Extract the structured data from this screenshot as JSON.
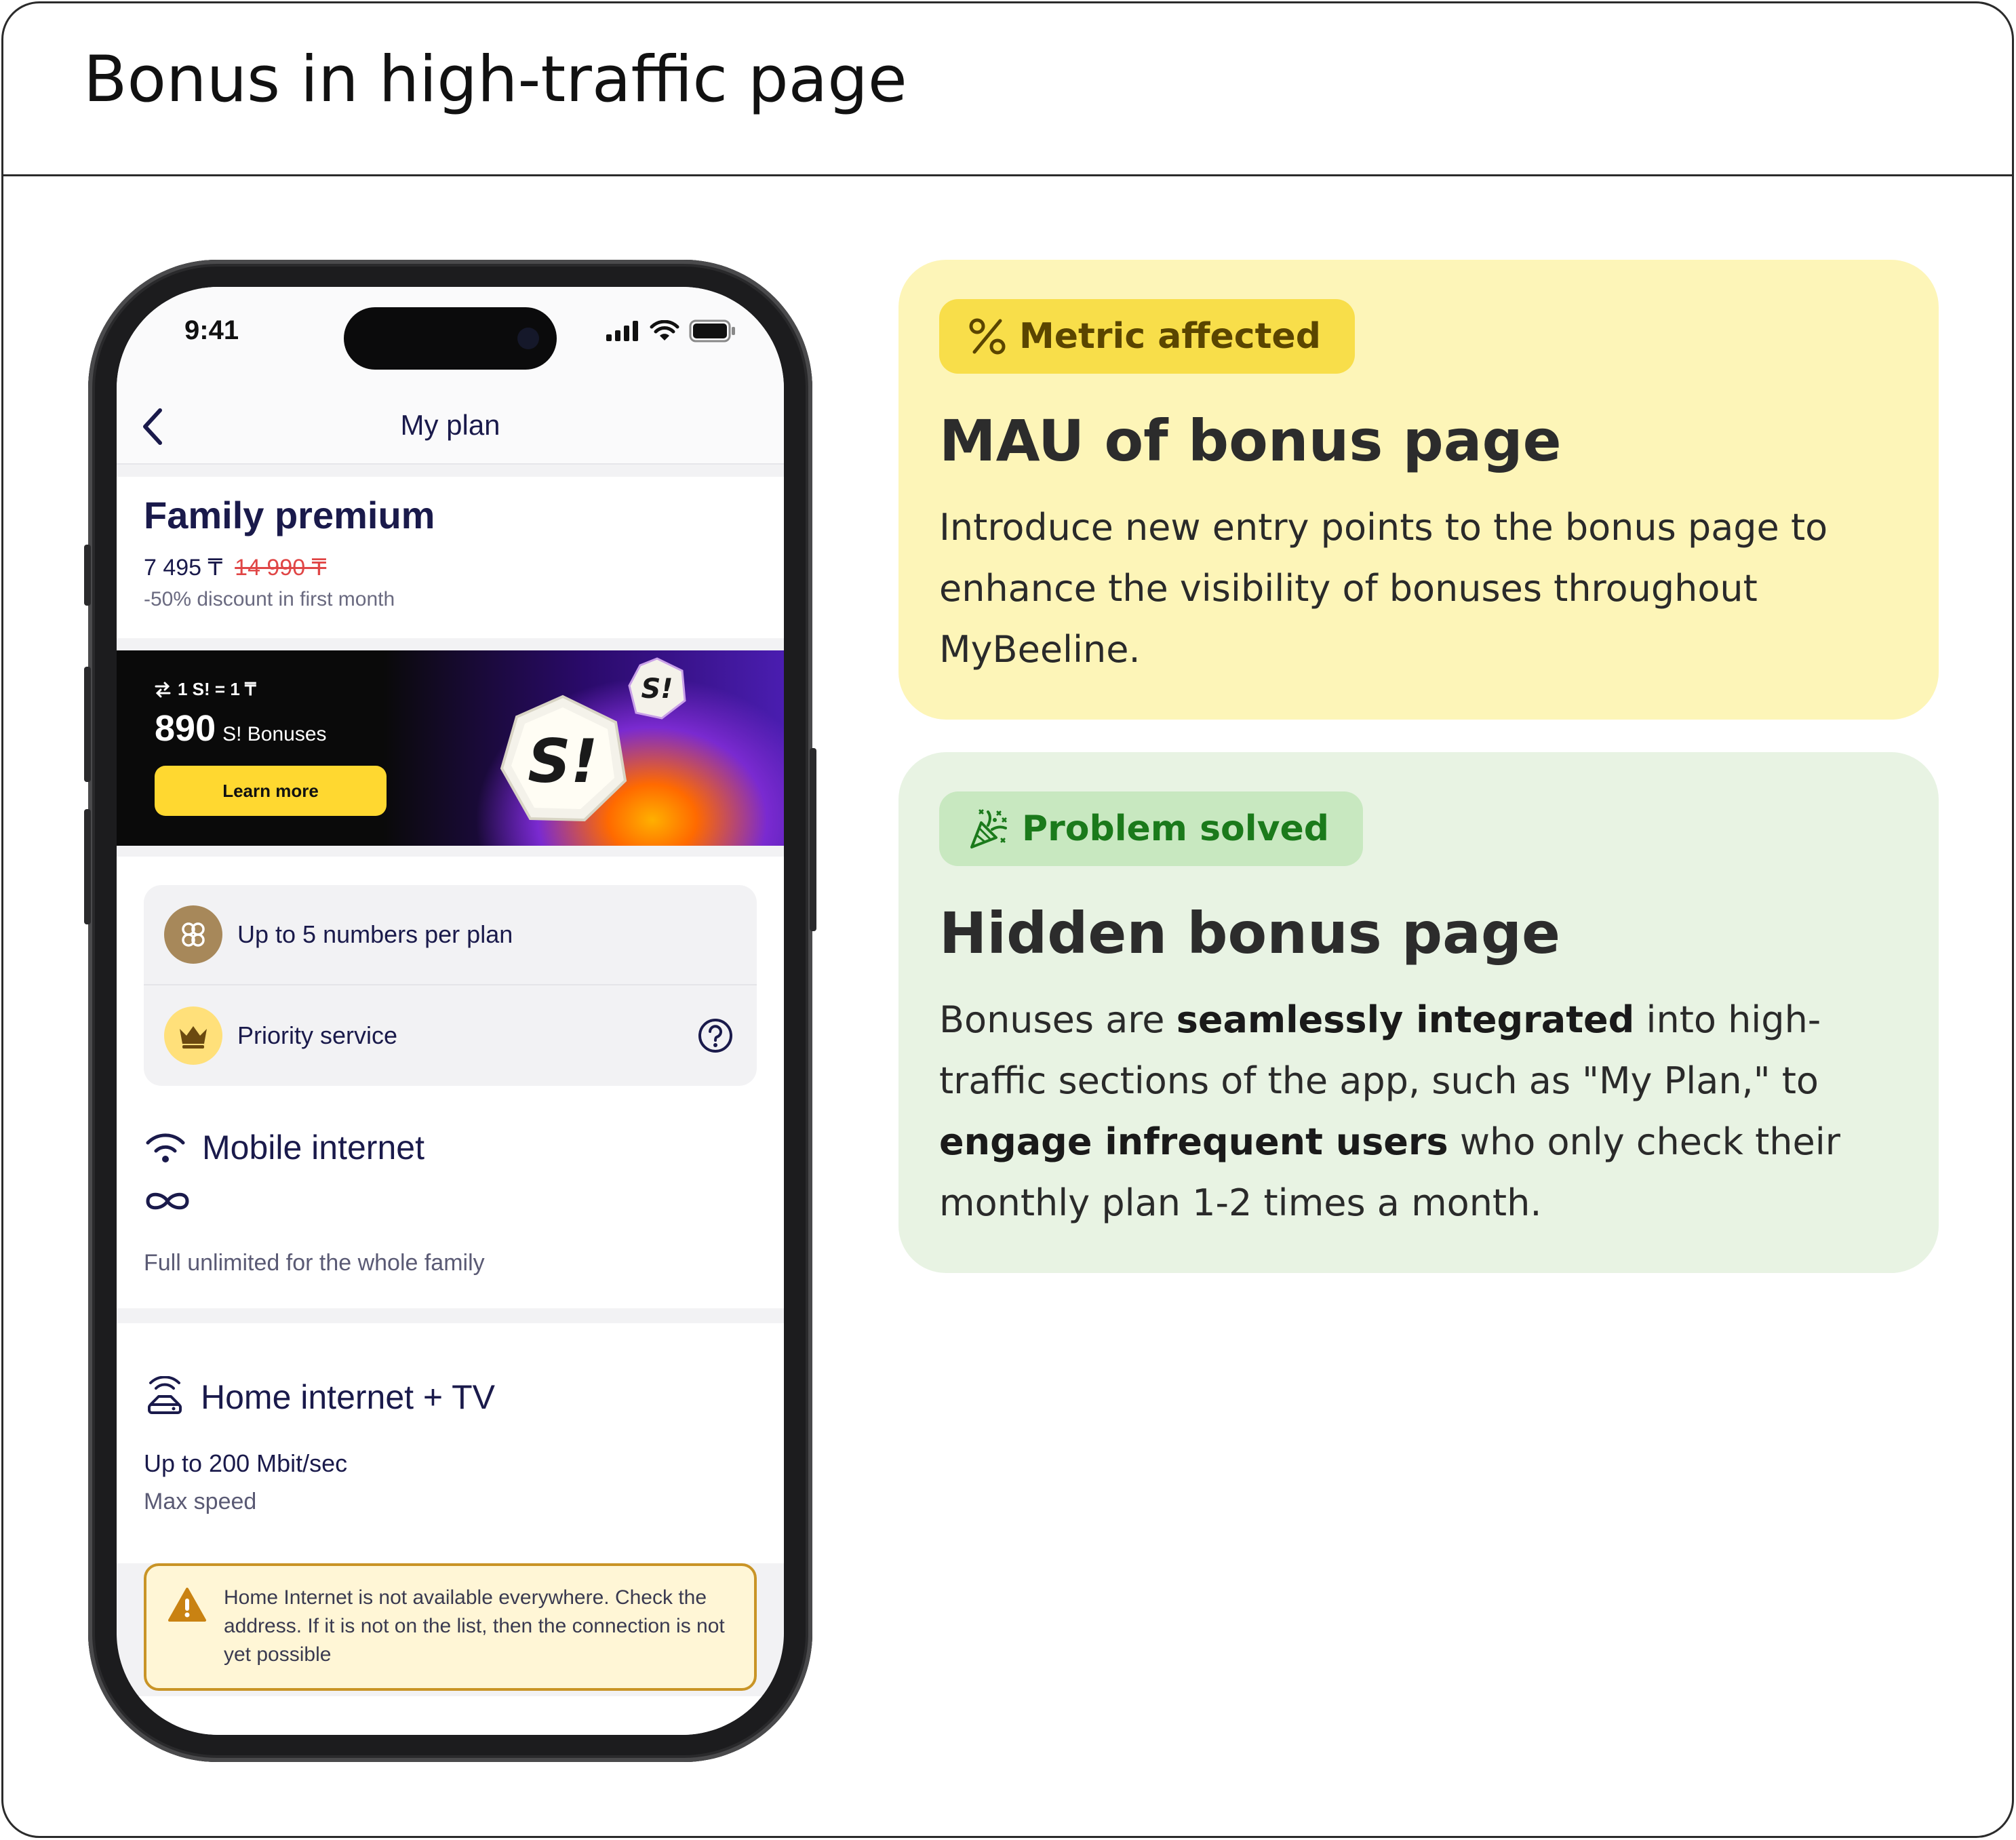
{
  "page": {
    "title": "Bonus in high-traffic page"
  },
  "phone": {
    "status": {
      "time": "9:41"
    },
    "nav": {
      "title": "My plan"
    },
    "plan": {
      "name": "Family premium",
      "price": "7 495 ₸",
      "old_price": "14 990 ₸",
      "discount": "-50% discount in first month"
    },
    "banner": {
      "rate": "1 S! = 1 ₸",
      "amount": "890",
      "label": "S! Bonuses",
      "button": "Learn more",
      "coin_text": "S!"
    },
    "features": [
      {
        "label": "Up to 5 numbers per plan",
        "icon": "family-icon"
      },
      {
        "label": "Priority service",
        "icon": "crown-icon"
      }
    ],
    "mobile_internet": {
      "title": "Mobile internet",
      "subtitle": "Full unlimited for the whole family"
    },
    "home_internet": {
      "title": "Home internet + TV",
      "speed": "Up to 200 Mbit/sec",
      "speed_label": "Max speed",
      "warning": "Home Internet is not available everywhere. Check the address. If it is not on the list, then the connection is not yet possible"
    }
  },
  "metric_card": {
    "badge": "Metric affected",
    "title": "MAU of bonus page",
    "body": "Introduce new entry points to the bonus page to enhance the visibility of bonuses throughout MyBeeline."
  },
  "problem_card": {
    "badge": "Problem solved",
    "title": "Hidden bonus page",
    "body_1": "Bonuses are ",
    "body_bold_1": "seamlessly integrated",
    "body_2": " into high-traffic sections of the app, such as \"My Plan,\" to ",
    "body_bold_2": "engage infrequent users",
    "body_3": " who only check their monthly plan 1-2 times a month."
  },
  "colors": {
    "metric_bg": "#fdf5b8",
    "metric_badge": "#f8de4a",
    "problem_bg": "#e8f3e3",
    "problem_badge": "#c8e8c0",
    "brand_yellow": "#ffd830",
    "navy_text": "#1a1a4b"
  }
}
